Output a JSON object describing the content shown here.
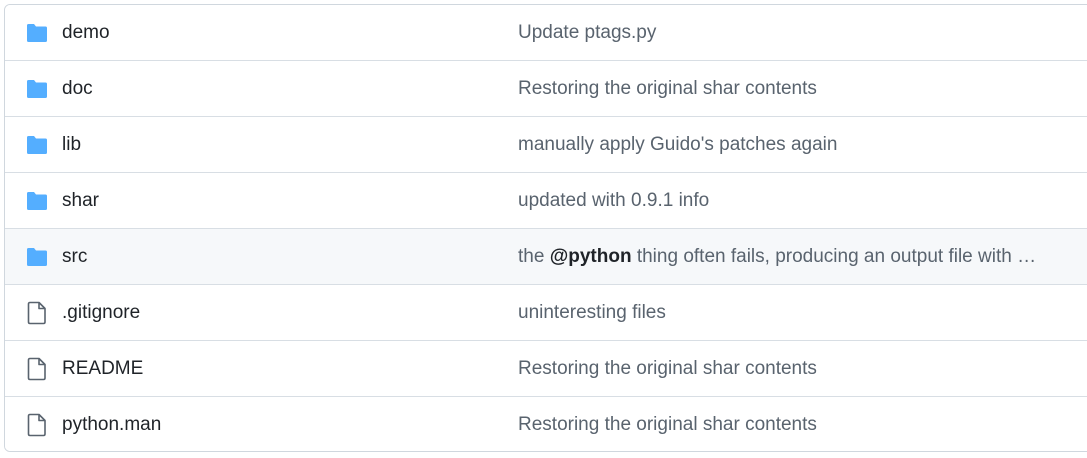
{
  "rows": [
    {
      "type": "folder",
      "name": "demo",
      "message": "Update ptags.py"
    },
    {
      "type": "folder",
      "name": "doc",
      "message": "Restoring the original shar contents"
    },
    {
      "type": "folder",
      "name": "lib",
      "message": "manually apply Guido's patches again"
    },
    {
      "type": "folder",
      "name": "shar",
      "message": "updated with 0.9.1 info"
    },
    {
      "type": "folder",
      "name": "src",
      "message_prefix": "the ",
      "message_mention": "@python",
      "message_suffix": " thing often fails, producing an output file with …"
    },
    {
      "type": "file",
      "name": ".gitignore",
      "message": "uninteresting files"
    },
    {
      "type": "file",
      "name": "README",
      "message": "Restoring the original shar contents"
    },
    {
      "type": "file",
      "name": "python.man",
      "message": "Restoring the original shar contents"
    }
  ],
  "colors": {
    "folder_icon": "#54aeff",
    "file_icon": "#59636e",
    "hover_row": "#f6f8fa"
  }
}
